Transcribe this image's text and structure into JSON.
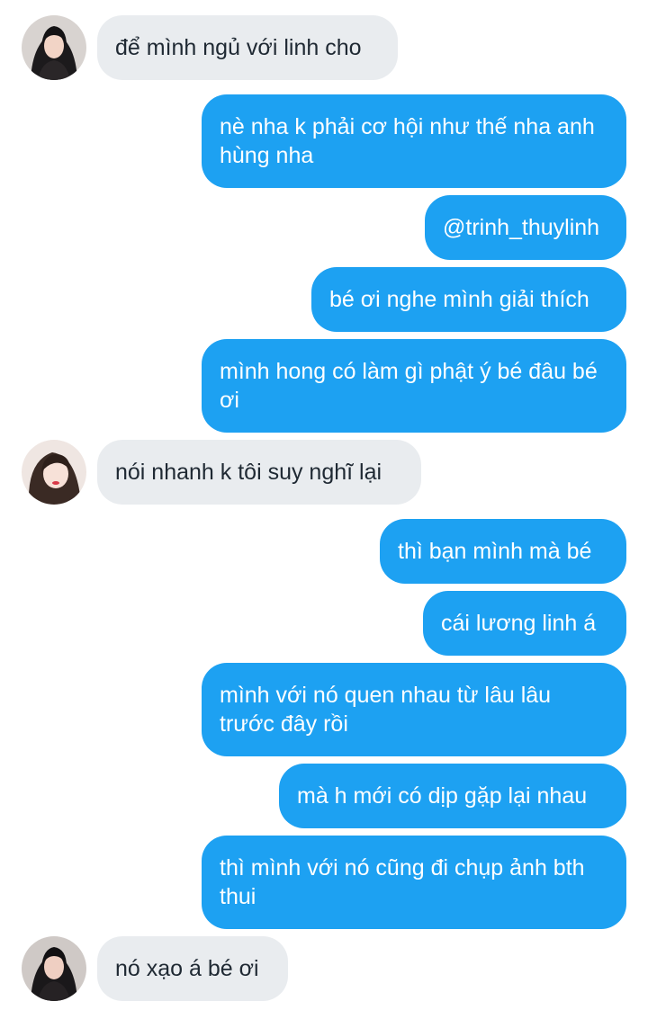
{
  "conversation": {
    "messages": [
      {
        "side": "in",
        "text": "để mình ngủ với linh cho"
      },
      {
        "side": "out",
        "text": "nè nha k phải cơ hội như thế nha anh hùng nha"
      },
      {
        "side": "out",
        "text": "@trinh_thuylinh"
      },
      {
        "side": "out",
        "text": "bé ơi nghe mình giải thích"
      },
      {
        "side": "out",
        "text": "mình hong có làm gì phật ý bé đâu bé ơi"
      },
      {
        "side": "in",
        "text": "nói nhanh k tôi suy nghĩ lại"
      },
      {
        "side": "out",
        "text": "thì bạn mình mà bé"
      },
      {
        "side": "out",
        "text": "cái lương linh á"
      },
      {
        "side": "out",
        "text": "mình với nó quen nhau từ lâu lâu trước đây rồi"
      },
      {
        "side": "out",
        "text": "mà h mới có dịp gặp lại nhau"
      },
      {
        "side": "out",
        "text": "thì mình với nó cũng đi chụp ảnh bth thui"
      },
      {
        "side": "in",
        "text": "nó xạo á bé ơi"
      }
    ]
  },
  "colors": {
    "outgoing_bubble": "#1da1f2",
    "incoming_bubble": "#e9ecef",
    "incoming_text": "#1f2933",
    "outgoing_text": "#ffffff"
  }
}
